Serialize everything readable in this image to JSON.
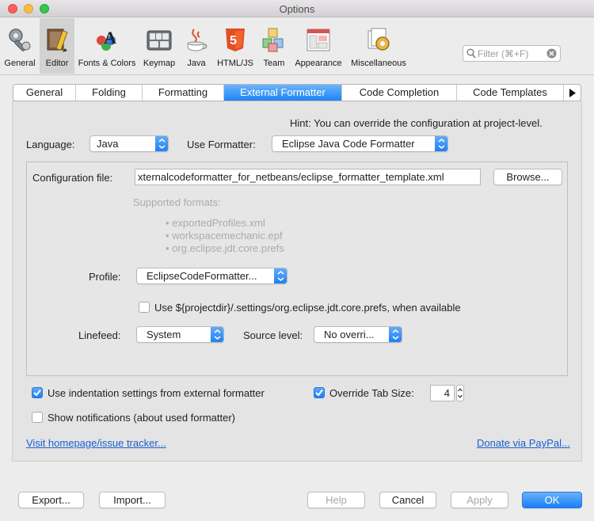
{
  "window": {
    "title": "Options"
  },
  "toolbar": {
    "items": [
      {
        "label": "General",
        "icon": "wrench-gear-icon"
      },
      {
        "label": "Editor",
        "icon": "editor-pencil-icon",
        "selected": true
      },
      {
        "label": "Fonts & Colors",
        "icon": "fonts-colors-icon"
      },
      {
        "label": "Keymap",
        "icon": "keyboard-icon"
      },
      {
        "label": "Java",
        "icon": "java-cup-icon"
      },
      {
        "label": "HTML/JS",
        "icon": "html5-icon"
      },
      {
        "label": "Team",
        "icon": "cubes-icon"
      },
      {
        "label": "Appearance",
        "icon": "window-layout-icon"
      },
      {
        "label": "Miscellaneous",
        "icon": "gear-documents-icon"
      }
    ],
    "filter_placeholder": "Filter (⌘+F)"
  },
  "tabs": [
    {
      "label": "General"
    },
    {
      "label": "Folding"
    },
    {
      "label": "Formatting"
    },
    {
      "label": "External Formatter",
      "active": true
    },
    {
      "label": "Code Completion"
    },
    {
      "label": "Code Templates"
    }
  ],
  "form": {
    "hint": "Hint: You can override the configuration at project-level.",
    "language_label": "Language:",
    "language_value": "Java",
    "use_formatter_label": "Use Formatter:",
    "use_formatter_value": "Eclipse Java Code Formatter",
    "config_file_label": "Configuration file:",
    "config_file_value": "xternalcodeformatter_for_netbeans/eclipse_formatter_template.xml",
    "browse_label": "Browse...",
    "supported_formats_label": "Supported formats:",
    "supported_formats": [
      "• exportedProfiles.xml",
      "• workspacemechanic.epf",
      "• org.eclipse.jdt.core.prefs"
    ],
    "profile_label": "Profile:",
    "profile_value": "EclipseCodeFormatter...",
    "use_projectdir_label": "Use ${projectdir}/.settings/org.eclipse.jdt.core.prefs, when available",
    "use_projectdir_checked": false,
    "linefeed_label": "Linefeed:",
    "linefeed_value": "System",
    "source_level_label": "Source level:",
    "source_level_value": "No overri...",
    "use_indentation_label": "Use indentation settings from external formatter",
    "use_indentation_checked": true,
    "override_tab_label": "Override Tab Size:",
    "override_tab_checked": true,
    "tab_size_value": "4",
    "show_notifications_label": "Show notifications (about used formatter)",
    "show_notifications_checked": false,
    "homepage_link": "Visit homepage/issue tracker...",
    "donate_link": "Donate via PayPal..."
  },
  "footer": {
    "export_label": "Export...",
    "import_label": "Import...",
    "help_label": "Help",
    "cancel_label": "Cancel",
    "apply_label": "Apply",
    "ok_label": "OK"
  },
  "colors": {
    "accent": "#1e84f6",
    "link": "#1a5fcf",
    "window_bg": "#ececec"
  }
}
